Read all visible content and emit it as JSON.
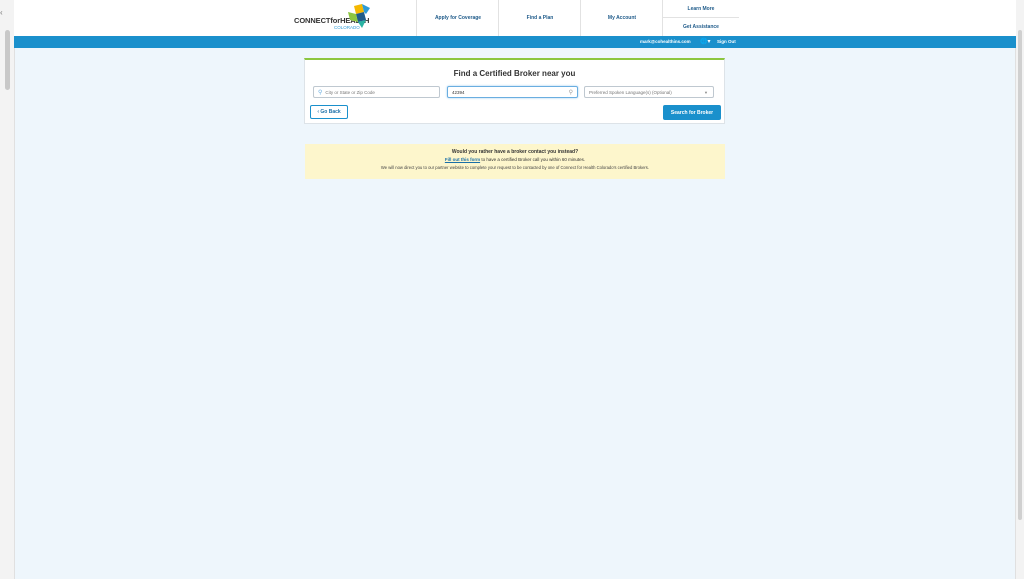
{
  "header": {
    "logo_text": "CONNECTforHEALTH",
    "logo_sub": "COLORADO",
    "nav": {
      "apply": "Apply for Coverage",
      "find_plan": "Find a Plan",
      "my_account": "My Account",
      "learn_more": "Learn More",
      "get_assistance": "Get Assistance"
    }
  },
  "bluebar": {
    "email": "mark@cohealthins.com",
    "globe_icon": "globe-icon",
    "sign_out": "Sign Out"
  },
  "search": {
    "title": "Find a Certified Broker near you",
    "city_placeholder": "City or State or Zip Code",
    "zip_value": "42394",
    "language_placeholder": "Preferred Spoken Language(s) (Optional)",
    "back_label": "Go Back",
    "search_label": "Search for Broker"
  },
  "notice": {
    "question": "Would you rather have a broker contact you instead?",
    "link_text": "Fill out this form",
    "line2_rest": " to have a certified Broker call you within 60 minutes.",
    "line3": "We will now direct you to our partner website to complete your request to be contacted by one of Connect for Health Colorado's certified Brokers."
  },
  "colors": {
    "brand_blue": "#1a90cc",
    "accent_green": "#8cc63f",
    "notice_bg": "#fdf6cc",
    "page_bg": "#eef6fc"
  }
}
